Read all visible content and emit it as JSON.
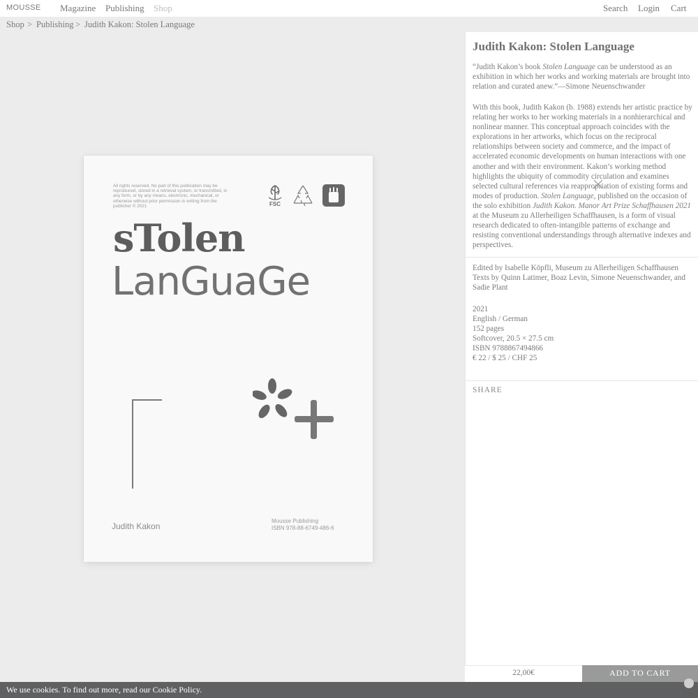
{
  "header": {
    "brand": "MOUSSE",
    "nav": [
      "Magazine",
      "Publishing",
      "Shop"
    ],
    "right": [
      "Search",
      "Login",
      "Cart"
    ]
  },
  "breadcrumb": {
    "items": [
      "Shop",
      "Publishing",
      "Judith Kakon: Stolen Language"
    ],
    "separator": ">"
  },
  "book_cover": {
    "legal": "All rights reserved. No part of this publication may be reproduced, stored in a retrieval system, or transmitted, in any form, or by any means, electronic, mechanical, or otherwise without prior permission in writing from the publisher © 2021",
    "fsc_label": "FSC",
    "title_line1": "sTolen",
    "title_line2": "LanGuaGe",
    "author": "Judith Kakon",
    "publisher": "Mousse Publishing",
    "isbn": "ISBN 978-88-6749-486-6"
  },
  "product": {
    "title": "Judith Kakon: Stolen Language",
    "quote_pre": "“Judith Kakon’s book ",
    "quote_italic": "Stolen Language",
    "quote_post": " can be understood as an exhibition in which her works and working materials are brought into relation and curated anew.”—Simone Neuenschwander",
    "desc_1": "With this book, Judith Kakon (b. 1988) extends her artistic practice by relating her works to her working materials in a nonhierarchical and nonlinear manner. This conceptual approach coincides with the explorations in her artworks, which focus on the reciprocal relationships between society and commerce, and the impact of accelerated economic developments on human interactions with one another and with their environment. Kakon’s working method highlights the ubiquity of commodity circulation and examines selected cultural references via reappropriation of existing forms and modes of production. ",
    "desc_italic_1": "Stolen Language",
    "desc_2": ", published on the occasion of the solo exhibition ",
    "desc_italic_2": "Judith Kakon. Manor Art Prize Schaffhausen 2021",
    "desc_3": " at the Museum zu Allerheiligen Schaffhausen, is a form of visual research dedicated to often-intangible patterns of exchange and resisting conventional understandings through alternative indexes and perspectives.",
    "editors": "Edited by Isabelle Köpfli, Museum zu Allerheiligen Schaffhausen",
    "texts": "Texts by Quinn Latimer, Boaz Levin, Simone Neuenschwander, and Sadie Plant",
    "specs": [
      "2021",
      "English / German",
      "152 pages",
      "Softcover, 20.5 × 27.5 cm",
      "ISBN 9788867494866",
      "€ 22 / $ 25 / CHF 25"
    ],
    "share": "SHARE",
    "price": "22,00€",
    "add_to_cart": "ADD TO CART"
  },
  "cookie": {
    "text": "We use cookies. To find out more, read our Cookie Policy."
  }
}
